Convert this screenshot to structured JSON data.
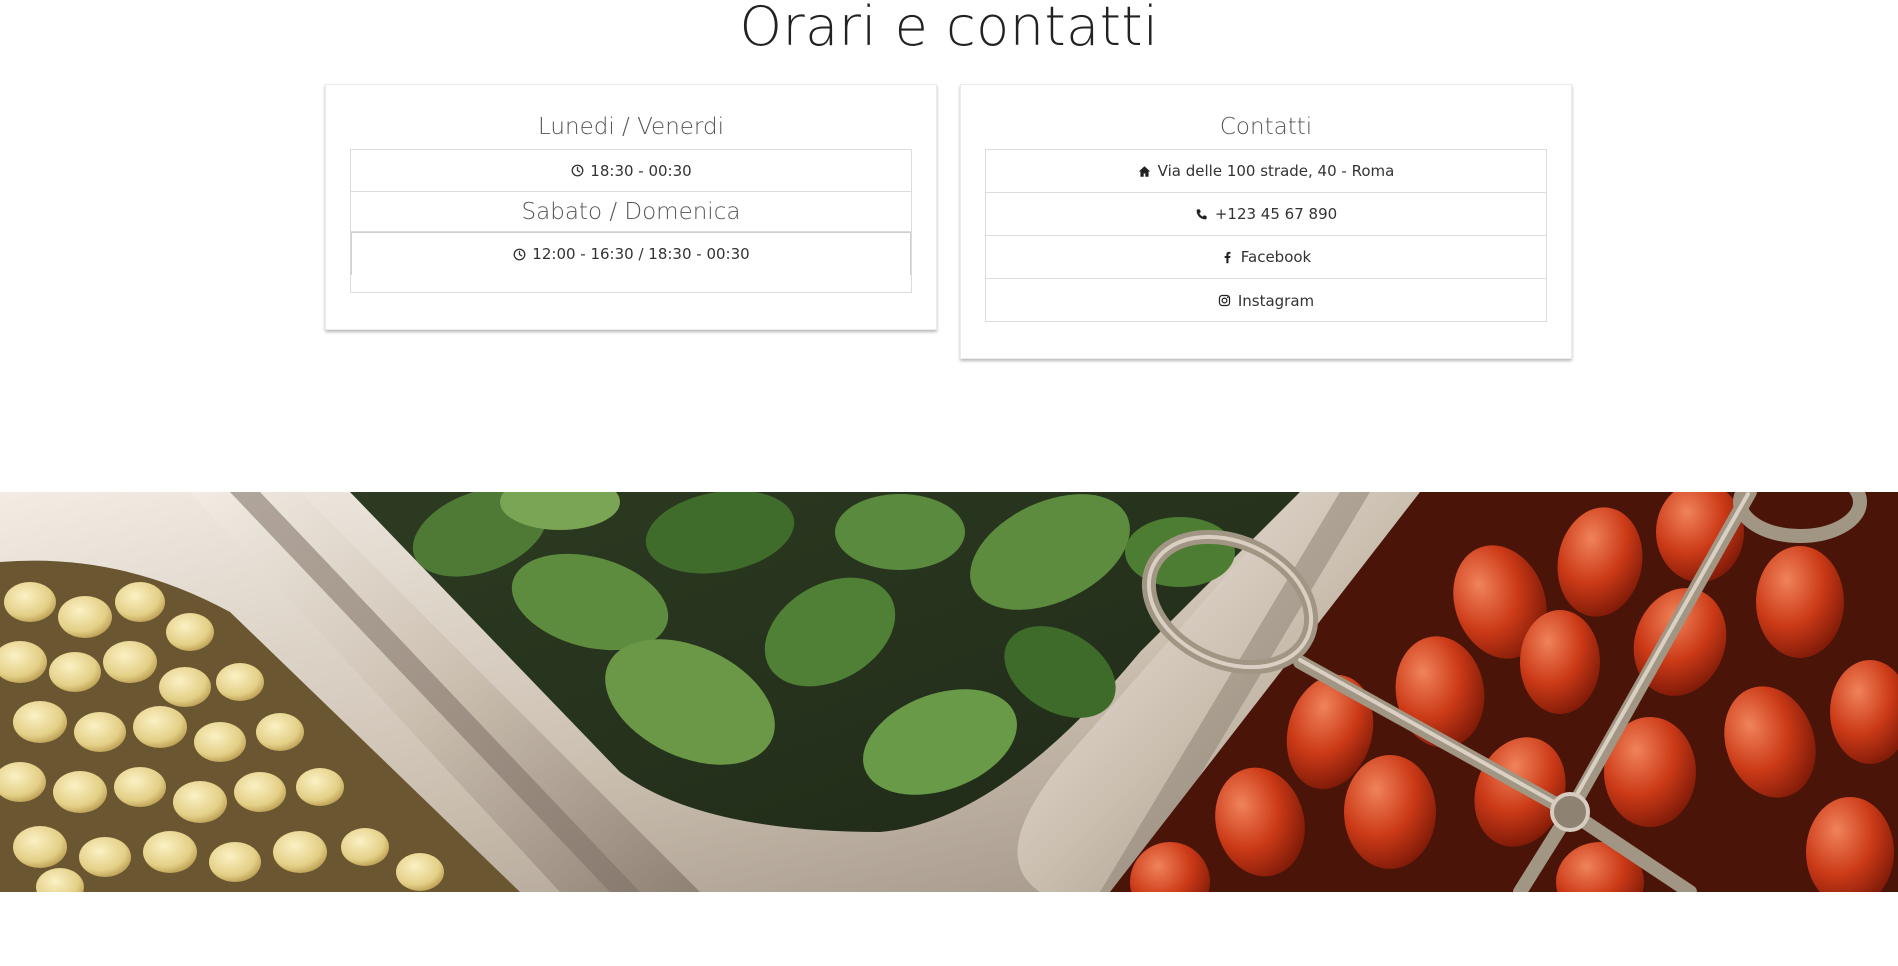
{
  "title": "Orari e contatti",
  "hours": {
    "weekdays_label": "Lunedi / Venerdi",
    "weekdays_time": "18:30 - 00:30",
    "weekend_label": "Sabato / Domenica",
    "weekend_time": "12:00 - 16:30 / 18:30 - 00:30"
  },
  "contacts": {
    "heading": "Contatti",
    "address": "Via delle 100 strade, 40 - Roma",
    "phone": "+123 45 67 890",
    "facebook": "Facebook",
    "instagram": "Instagram"
  },
  "icons": {
    "clock": "clock-icon",
    "home": "home-icon",
    "phone": "phone-icon",
    "facebook": "facebook-icon",
    "instagram": "instagram-icon"
  }
}
